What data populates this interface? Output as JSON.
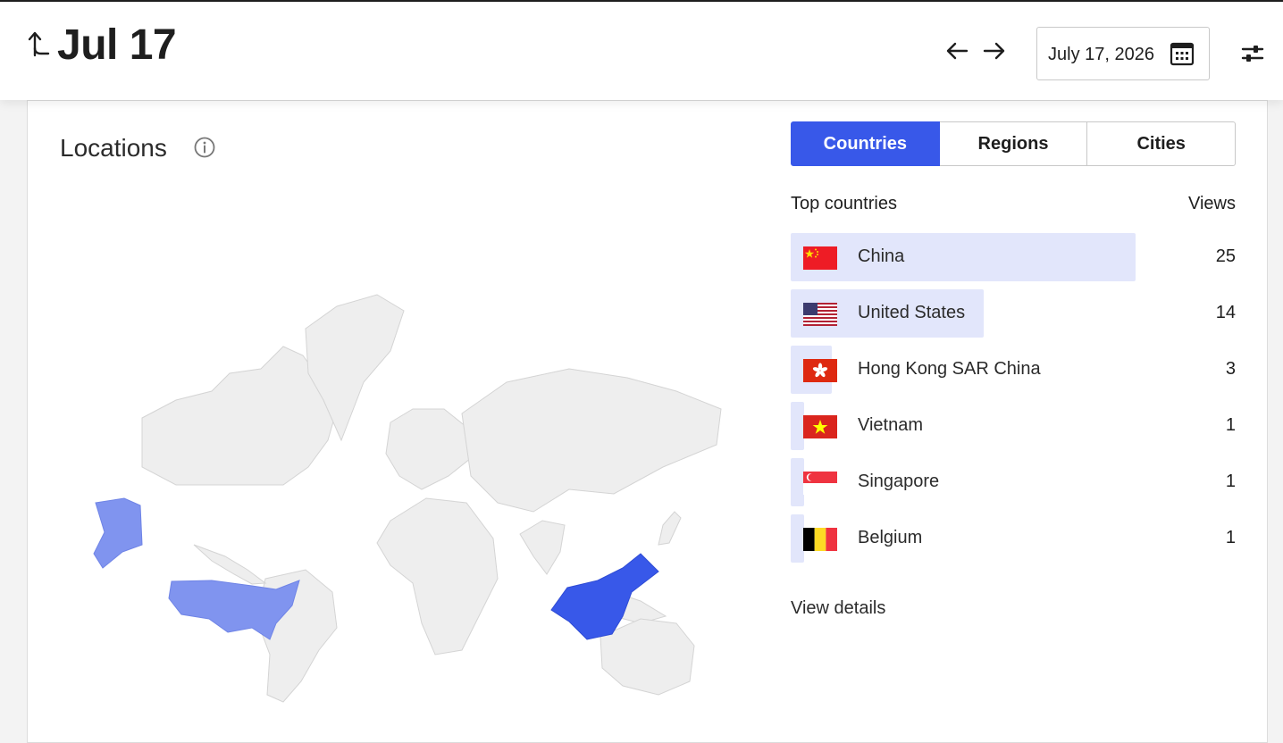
{
  "header": {
    "title": "Jul 17",
    "date_value": "July 17, 2026",
    "icons": {
      "back": "back-up-arrow-icon",
      "prev": "arrow-left-icon",
      "next": "arrow-right-icon",
      "calendar": "calendar-icon",
      "settings": "sliders-icon"
    }
  },
  "locations": {
    "heading": "Locations",
    "info_icon": "info-icon",
    "tabs": [
      {
        "label": "Countries",
        "active": true
      },
      {
        "label": "Regions",
        "active": false
      },
      {
        "label": "Cities",
        "active": false
      }
    ],
    "list_title": "Top countries",
    "views_label": "Views",
    "rows": [
      {
        "name": "China",
        "views": 25,
        "flag": "china-flag-icon"
      },
      {
        "name": "United States",
        "views": 14,
        "flag": "us-flag-icon"
      },
      {
        "name": "Hong Kong SAR China",
        "views": 3,
        "flag": "hong-kong-flag-icon"
      },
      {
        "name": "Vietnam",
        "views": 1,
        "flag": "vietnam-flag-icon"
      },
      {
        "name": "Singapore",
        "views": 1,
        "flag": "singapore-flag-icon"
      },
      {
        "name": "Belgium",
        "views": 1,
        "flag": "belgium-flag-icon"
      }
    ],
    "view_details": "View details"
  },
  "colors": {
    "accent": "#3858e9",
    "bar_bg": "#e2e6fb",
    "map_land": "#eeeeee",
    "map_us": "#8094ef",
    "map_cn": "#3858e9"
  }
}
